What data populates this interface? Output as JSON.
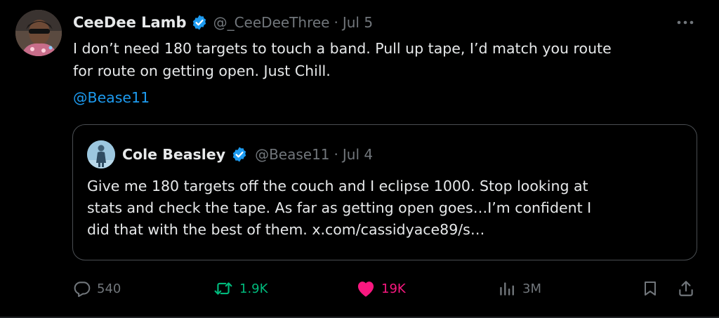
{
  "tweet": {
    "author": {
      "name": "CeeDee Lamb",
      "handle": "@_CeeDeeThree",
      "separator": "·",
      "date": "Jul 5"
    },
    "text": "I don’t need 180 targets to touch a band. Pull up tape, I’d match you route\nfor route on getting open. Just Chill.",
    "mention": "@Bease11",
    "quoted": {
      "name": "Cole Beasley",
      "handle": "@Bease11",
      "separator": "·",
      "date": "Jul 4",
      "text": "Give me 180 targets off the couch and I eclipse 1000. Stop looking at\nstats and check the tape. As far as getting open goes…I’m confident I\ndid that with the best of them. x.com/cassidyace89/s…"
    },
    "metrics": {
      "replies": "540",
      "retweets": "1.9K",
      "likes": "19K",
      "views": "3M"
    }
  },
  "icons": {
    "verified": "verified-badge-icon",
    "more": "more-options-icon",
    "reply": "reply-icon",
    "retweet": "retweet-icon",
    "like": "heart-icon",
    "views": "views-icon",
    "bookmark": "bookmark-icon",
    "share": "share-icon"
  },
  "colors": {
    "background": "#000000",
    "text": "#e7e9ea",
    "secondary": "#71767b",
    "link": "#1d9bf0",
    "verified": "#1d9bf0",
    "retweet": "#00ba7c",
    "like": "#f91880"
  }
}
